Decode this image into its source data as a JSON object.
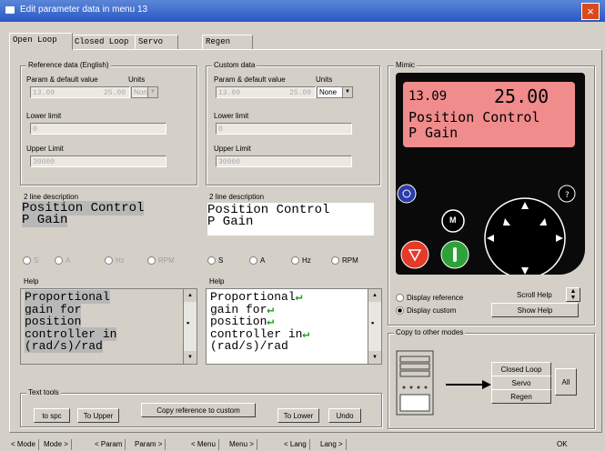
{
  "window": {
    "title": "Edit parameter data in menu 13",
    "close": "×"
  },
  "tabs": [
    "Open Loop",
    "Closed Loop",
    "Servo",
    "Regen"
  ],
  "reference": {
    "group": "Reference data (English)",
    "param_default_label": "Param & default value",
    "units_label": "Units",
    "param": "13.09",
    "default": "25.00",
    "units": "None",
    "lower_label": "Lower limit",
    "lower_value": "0",
    "upper_label": "Upper Limit",
    "upper_value": "30000",
    "desc_label": "2 line description",
    "desc_line1": "Position Control",
    "desc_line2": "P Gain",
    "radios": [
      "S",
      "A",
      "Hz",
      "RPM"
    ],
    "help_label": "Help",
    "help_lines": [
      "Proportional",
      "gain for",
      "position",
      "controller in",
      "(rad/s)/rad"
    ]
  },
  "custom": {
    "group": "Custom data",
    "param_default_label": "Param & default value",
    "units_label": "Units",
    "param": "13.09",
    "default": "25.00",
    "units": "None",
    "lower_label": "Lower limit",
    "lower_value": "0",
    "upper_label": "Upper Limit",
    "upper_value": "30000",
    "desc_label": "2 line description",
    "desc_line1": "Position Control",
    "desc_line2": "P Gain",
    "radios": [
      "S",
      "A",
      "Hz",
      "RPM"
    ],
    "help_label": "Help",
    "help_lines": [
      "Proportional",
      "gain for",
      "position",
      "controller in",
      "(rad/s)/rad"
    ]
  },
  "mimic": {
    "group": "Mimic",
    "lcd_param": "13.09",
    "lcd_value": "25.00",
    "lcd_line1": "Position Control",
    "lcd_line2": "P Gain",
    "m_key": "M",
    "display_reference": "Display reference",
    "display_custom": "Display custom",
    "scroll_help": "Scroll Help",
    "show_help": "Show Help"
  },
  "copy": {
    "group": "Copy to other modes",
    "closed_loop": "Closed Loop",
    "servo": "Servo",
    "regen": "Regen",
    "all": "All"
  },
  "text_tools": {
    "group": "Text tools",
    "to_spc": "to spc",
    "to_upper": "To Upper",
    "copy_ref": "Copy reference to custom",
    "to_lower": "To Lower",
    "undo": "Undo"
  },
  "bottom": [
    "< Mode",
    "Mode >",
    "< Param",
    "Param >",
    "< Menu",
    "Menu >",
    "< Lang",
    "Lang >",
    "OK"
  ]
}
